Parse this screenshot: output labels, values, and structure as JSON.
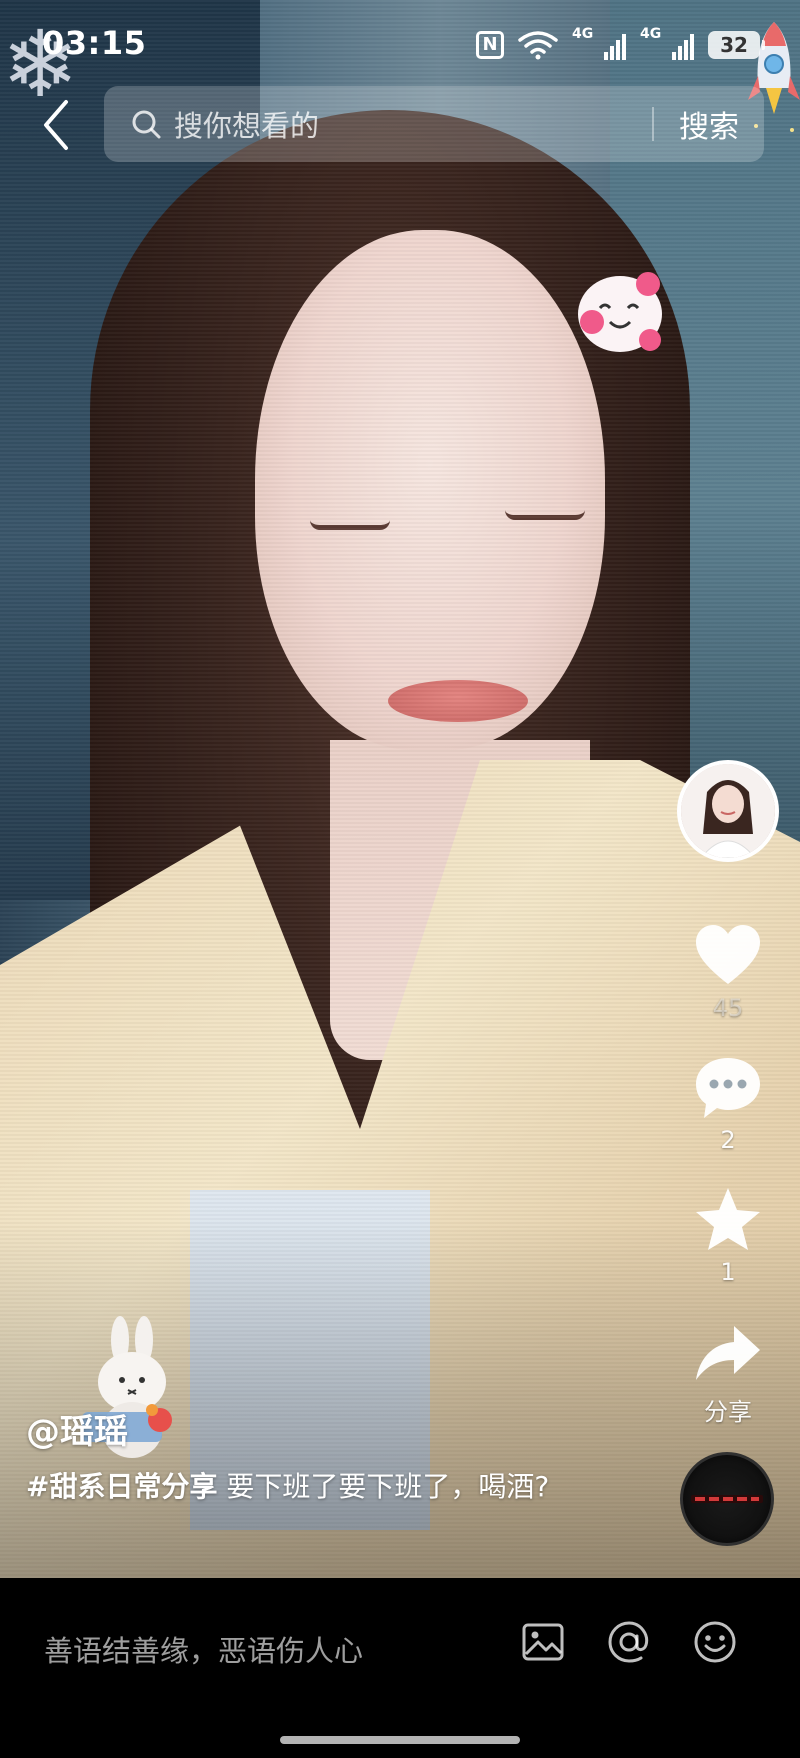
{
  "status_bar": {
    "time": "03:15",
    "nfc_label": "N",
    "signal_1_label": "4G",
    "signal_2_label": "4G",
    "battery": "32"
  },
  "search": {
    "placeholder": "搜你想看的",
    "button_label": "搜索"
  },
  "actions": {
    "like_count": "45",
    "comment_count": "2",
    "favorite_count": "1",
    "share_label": "分享"
  },
  "post": {
    "author": "@瑶瑶",
    "hashtag": "#甜系日常分享",
    "text": " 要下班了要下班了，喝酒?"
  },
  "comment_bar": {
    "placeholder": "善语结善缘，恶语伤人心"
  },
  "icons": [
    "back-icon",
    "search-icon",
    "heart-icon",
    "comment-icon",
    "star-icon",
    "share-icon",
    "image-icon",
    "at-icon",
    "emoji-icon"
  ]
}
